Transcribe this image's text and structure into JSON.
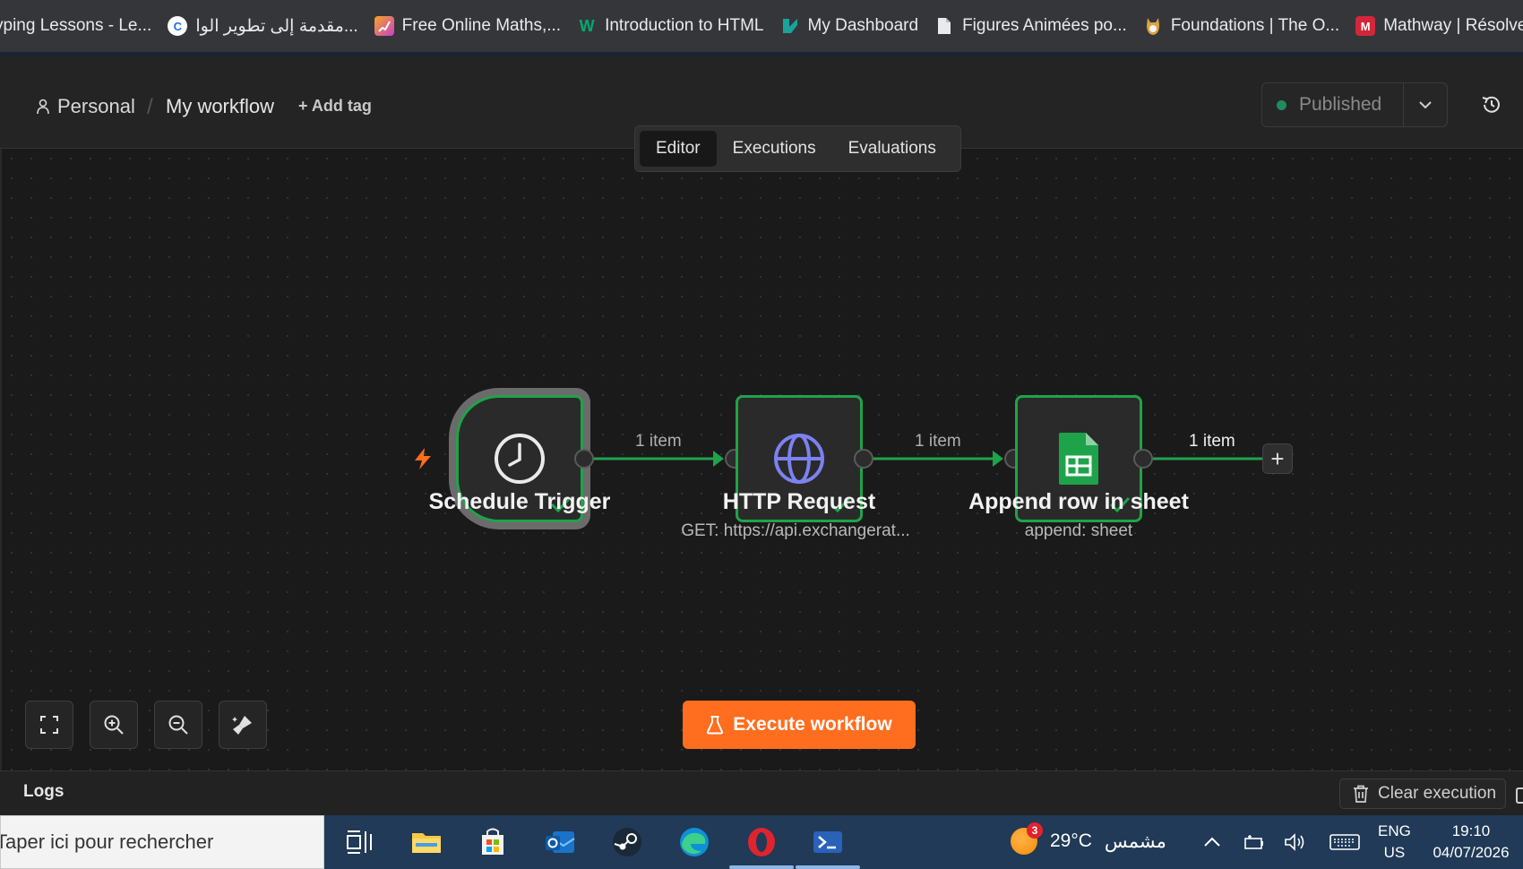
{
  "bookmarks": [
    {
      "label": "yping Lessons - Le...",
      "icon": "typing-icon",
      "color": "#35363a"
    },
    {
      "label": "مقدمة إلى تطوير الوا...",
      "icon": "coursera-icon",
      "color": "#1f6feb"
    },
    {
      "label": "Free Online Maths,...",
      "icon": "maths-icon",
      "color": "#c840c8"
    },
    {
      "label": "Introduction to HTML",
      "icon": "w3-icon",
      "color": "#04aa6d"
    },
    {
      "label": "My Dashboard",
      "icon": "dashboard-icon",
      "color": "#19a39a"
    },
    {
      "label": "Figures Animées po...",
      "icon": "document-icon",
      "color": "#e8eaed"
    },
    {
      "label": "Foundations | The O...",
      "icon": "odin-icon",
      "color": "#d9a441"
    },
    {
      "label": "Mathway | Résolveu...",
      "icon": "mathway-icon",
      "color": "#d3263a"
    }
  ],
  "header": {
    "project": "Personal",
    "workflow_name": "My workflow",
    "add_tag": "+ Add tag",
    "publish_status": "Published",
    "status_color": "#1f8c5e"
  },
  "tabs": [
    "Editor",
    "Executions",
    "Evaluations"
  ],
  "active_tab": "Editor",
  "nodes": [
    {
      "title": "Schedule Trigger",
      "subtitle": "",
      "icon": "clock-icon"
    },
    {
      "title": "HTTP Request",
      "subtitle": "GET: https://api.exchangerat...",
      "icon": "globe-icon"
    },
    {
      "title": "Append row in sheet",
      "subtitle": "append: sheet",
      "icon": "google-sheets-icon"
    }
  ],
  "connections": [
    {
      "label": "1 item"
    },
    {
      "label": "1 item"
    },
    {
      "label": "1 item"
    }
  ],
  "canvas": {
    "execute_button": "Execute workflow",
    "controls": [
      "fit-view-icon",
      "zoom-in-icon",
      "zoom-out-icon",
      "tidy-up-icon"
    ],
    "accent": "#ff6d1e",
    "success_color": "#1fa34a"
  },
  "logs": {
    "title": "Logs",
    "clear_button": "Clear execution"
  },
  "taskbar": {
    "search_placeholder": "Taper ici pour rechercher",
    "weather_temp": "29°C",
    "weather_text": "مشمس",
    "weather_badge": "3",
    "lang_line1": "ENG",
    "lang_line2": "US",
    "time": "19:10",
    "date": "04/07/2026"
  }
}
